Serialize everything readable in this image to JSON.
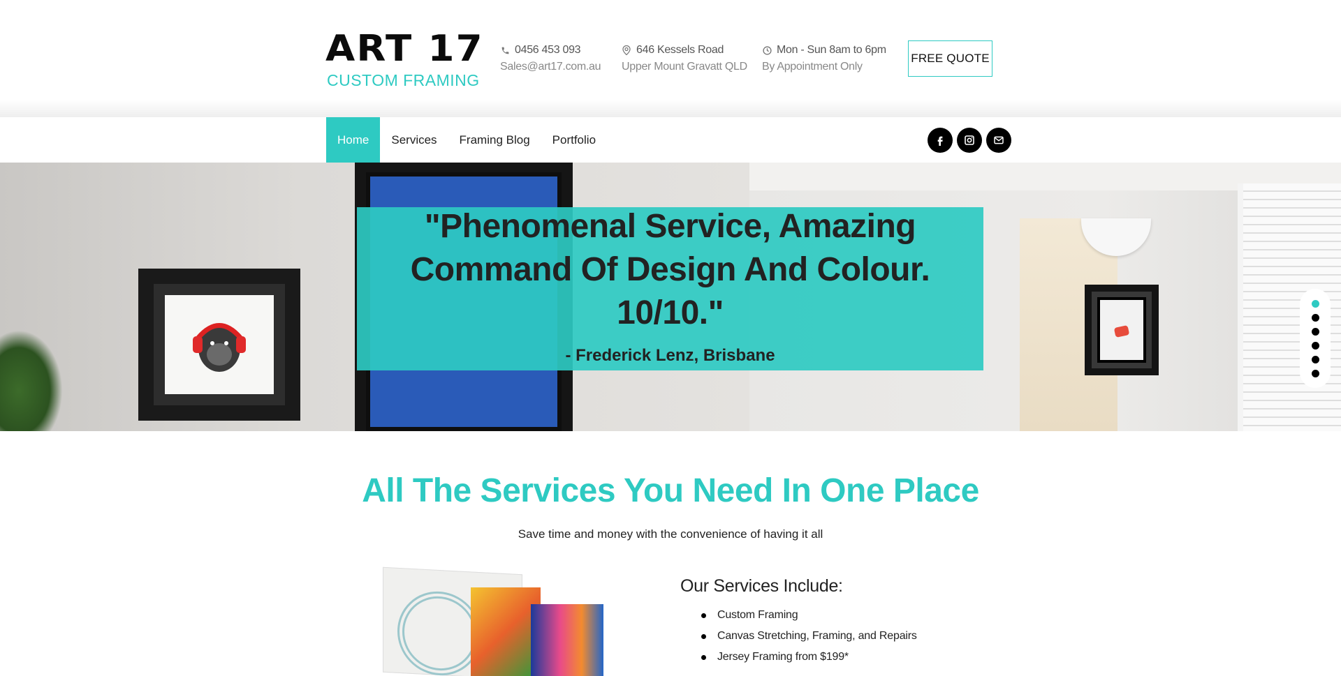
{
  "header": {
    "logo_title": "ART 17",
    "logo_subtitle": "CUSTOM FRAMING",
    "phone": "0456 453 093",
    "email": "Sales@art17.com.au",
    "address_line1": "646 Kessels Road",
    "address_line2": "Upper Mount Gravatt QLD",
    "hours_line1": "Mon - Sun 8am to 6pm",
    "hours_line2": "By Appointment Only",
    "quote_button": "FREE QUOTE"
  },
  "nav": {
    "items": [
      {
        "label": "Home",
        "active": true
      },
      {
        "label": "Services",
        "active": false
      },
      {
        "label": "Framing Blog",
        "active": false
      },
      {
        "label": "Portfolio",
        "active": false
      }
    ],
    "social": [
      "facebook-icon",
      "instagram-icon",
      "mail-icon"
    ]
  },
  "hero": {
    "quote": "\"Phenomenal Service, Amazing Command Of Design And Colour. 10/10.\"",
    "author": "- Frederick Lenz, Brisbane",
    "slide_count": 6,
    "active_slide": 1
  },
  "services": {
    "title": "All The Services You Need In One Place",
    "subtitle": "Save time and money with the convenience of having it all",
    "includes_title": "Our Services Include:",
    "items": [
      "Custom Framing",
      "Canvas Stretching, Framing, and Repairs",
      "Jersey Framing from $199*"
    ]
  },
  "colors": {
    "accent": "#2ecac2",
    "text": "#222222",
    "muted": "#888888"
  }
}
